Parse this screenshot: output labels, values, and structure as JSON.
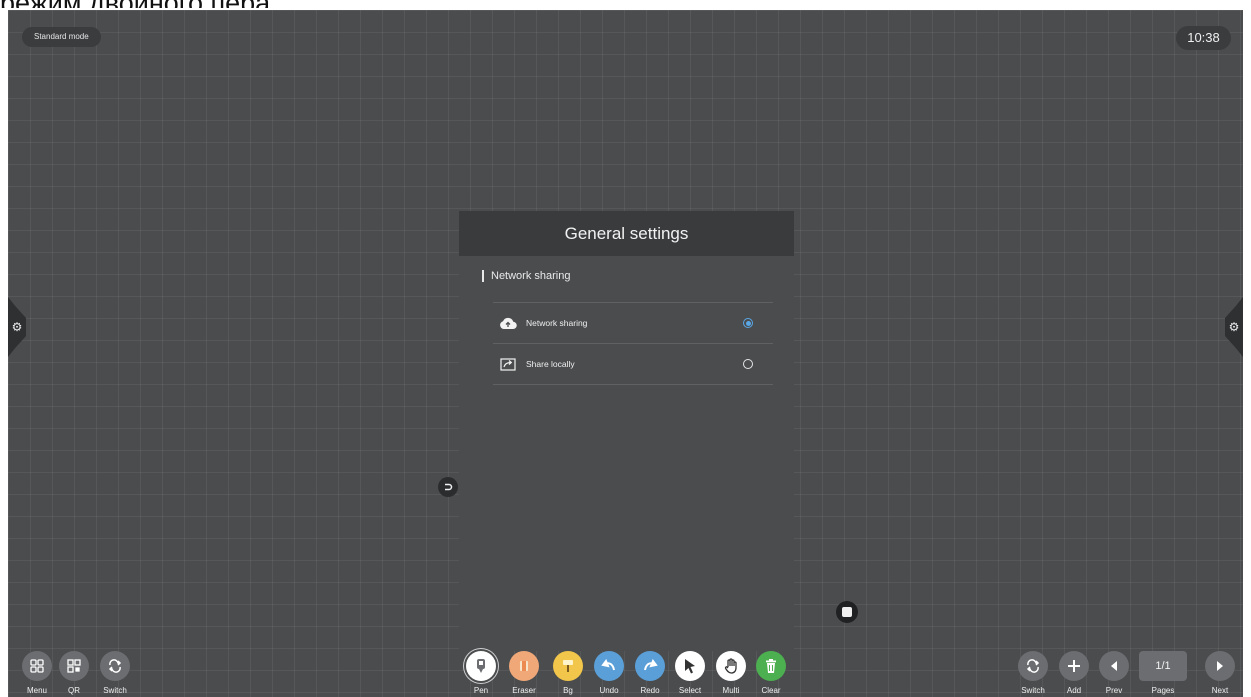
{
  "overlay_caption": "режим двойного пера.",
  "status": {
    "mode": "Standard mode",
    "clock": "10:38"
  },
  "dialog": {
    "title": "General settings",
    "section": "Network sharing",
    "options": [
      {
        "label": "Network sharing",
        "icon": "cloud-icon",
        "selected": true
      },
      {
        "label": "Share locally",
        "icon": "share-icon",
        "selected": false
      }
    ]
  },
  "toolbar": {
    "left": [
      {
        "label": "Menu",
        "icon": "grid-icon"
      },
      {
        "label": "QR",
        "icon": "qr-icon"
      },
      {
        "label": "Switch",
        "icon": "switch-icon"
      }
    ],
    "center": [
      {
        "label": "Pen",
        "icon": "pen-icon",
        "color": "#ffffff"
      },
      {
        "label": "Eraser",
        "icon": "eraser-icon",
        "color": "#f0a878"
      },
      {
        "label": "Bg",
        "icon": "paint-roller-icon",
        "color": "#f2c64a"
      },
      {
        "label": "Undo",
        "icon": "undo-icon",
        "color": "#5a9fd8"
      },
      {
        "label": "Redo",
        "icon": "redo-icon",
        "color": "#5a9fd8"
      },
      {
        "label": "Select",
        "icon": "cursor-icon",
        "color": "#333333"
      },
      {
        "label": "Multi",
        "icon": "hand-icon",
        "color": "#333333"
      },
      {
        "label": "Clear",
        "icon": "trash-icon",
        "color": "#4caf50"
      }
    ],
    "right": [
      {
        "label": "Switch",
        "icon": "switch-icon"
      },
      {
        "label": "Add",
        "icon": "plus-icon"
      },
      {
        "label": "Prev",
        "icon": "prev-icon"
      },
      {
        "label": "Pages",
        "value": "1/1"
      },
      {
        "label": "Next",
        "icon": "next-icon"
      }
    ]
  }
}
